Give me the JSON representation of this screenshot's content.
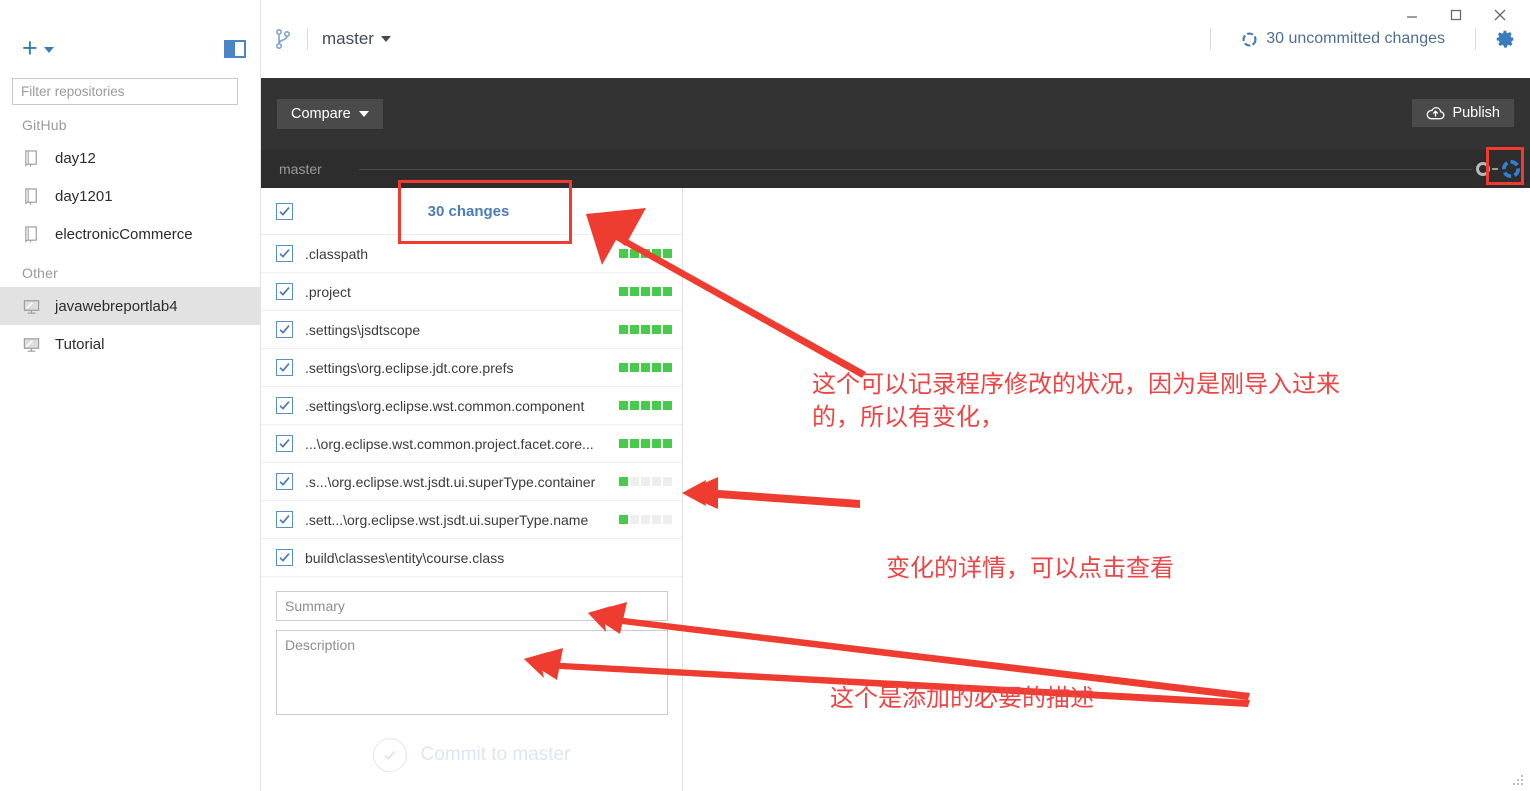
{
  "window": {
    "minimize_label": "minimize",
    "maximize_label": "maximize",
    "close_label": "close"
  },
  "sidebar": {
    "add_button_label": "+",
    "panel_toggle_label": "toggle-panel",
    "filter": {
      "placeholder": "Filter repositories",
      "value": ""
    },
    "groups": [
      {
        "label": "GitHub",
        "items": [
          {
            "label": "day12",
            "icon": "repo-book-icon",
            "selected": false
          },
          {
            "label": "day1201",
            "icon": "repo-book-icon",
            "selected": false
          },
          {
            "label": "electronicCommerce",
            "icon": "repo-book-icon",
            "selected": false
          }
        ]
      },
      {
        "label": "Other",
        "items": [
          {
            "label": "javawebreportlab4",
            "icon": "repo-local-icon",
            "selected": true
          },
          {
            "label": "Tutorial",
            "icon": "repo-local-icon",
            "selected": false
          }
        ]
      }
    ]
  },
  "topbar": {
    "branch_icon": "branch-icon",
    "branch_name": "master",
    "uncommitted_changes": "30 uncommitted changes",
    "uncommitted_icon": "sync-ring-icon",
    "settings_icon": "gear-icon"
  },
  "toolbar": {
    "compare_label": "Compare",
    "publish_label": "Publish",
    "publish_icon": "cloud-upload-icon",
    "timeline_branch_label": "master",
    "timeline_current_icon": "sync-ring-icon"
  },
  "changes": {
    "select_all_checked": true,
    "count_label": "30 changes",
    "files": [
      {
        "name": ".classpath",
        "checked": true,
        "diff": [
          "g",
          "g",
          "g",
          "g",
          "g"
        ]
      },
      {
        "name": ".project",
        "checked": true,
        "diff": [
          "g",
          "g",
          "g",
          "g",
          "g"
        ]
      },
      {
        "name": ".settings\\jsdtscope",
        "checked": true,
        "diff": [
          "g",
          "g",
          "g",
          "g",
          "g"
        ]
      },
      {
        "name": ".settings\\org.eclipse.jdt.core.prefs",
        "checked": true,
        "diff": [
          "g",
          "g",
          "g",
          "g",
          "g"
        ]
      },
      {
        "name": ".settings\\org.eclipse.wst.common.component",
        "checked": true,
        "diff": [
          "g",
          "g",
          "g",
          "g",
          "g"
        ]
      },
      {
        "name": "...\\org.eclipse.wst.common.project.facet.core...",
        "checked": true,
        "diff": [
          "g",
          "g",
          "g",
          "g",
          "g"
        ]
      },
      {
        "name": ".s...\\org.eclipse.wst.jsdt.ui.superType.container",
        "checked": true,
        "diff": [
          "g",
          "n",
          "n",
          "n",
          "n"
        ]
      },
      {
        "name": ".sett...\\org.eclipse.wst.jsdt.ui.superType.name",
        "checked": true,
        "diff": [
          "g",
          "n",
          "n",
          "n",
          "n"
        ]
      },
      {
        "name": "build\\classes\\entity\\course.class",
        "checked": true,
        "diff": []
      }
    ]
  },
  "commit": {
    "summary_placeholder": "Summary",
    "summary_value": "",
    "description_placeholder": "Description",
    "description_value": "",
    "button_label": "Commit to master",
    "button_icon": "check-circle-icon"
  },
  "annotations": [
    {
      "text": "这个可以记录程序修改的状况，因为是刚导入过来\n的，所以有变化，"
    },
    {
      "text": "变化的详情，可以点击查看"
    },
    {
      "text": "这个是添加的必要的描述"
    }
  ],
  "colors": {
    "accent_blue": "#4a7db5",
    "annotation_red": "#ee4444",
    "highlight_red": "#f23b30",
    "diff_green": "#46cb4a",
    "dark_toolbar": "#333333"
  }
}
